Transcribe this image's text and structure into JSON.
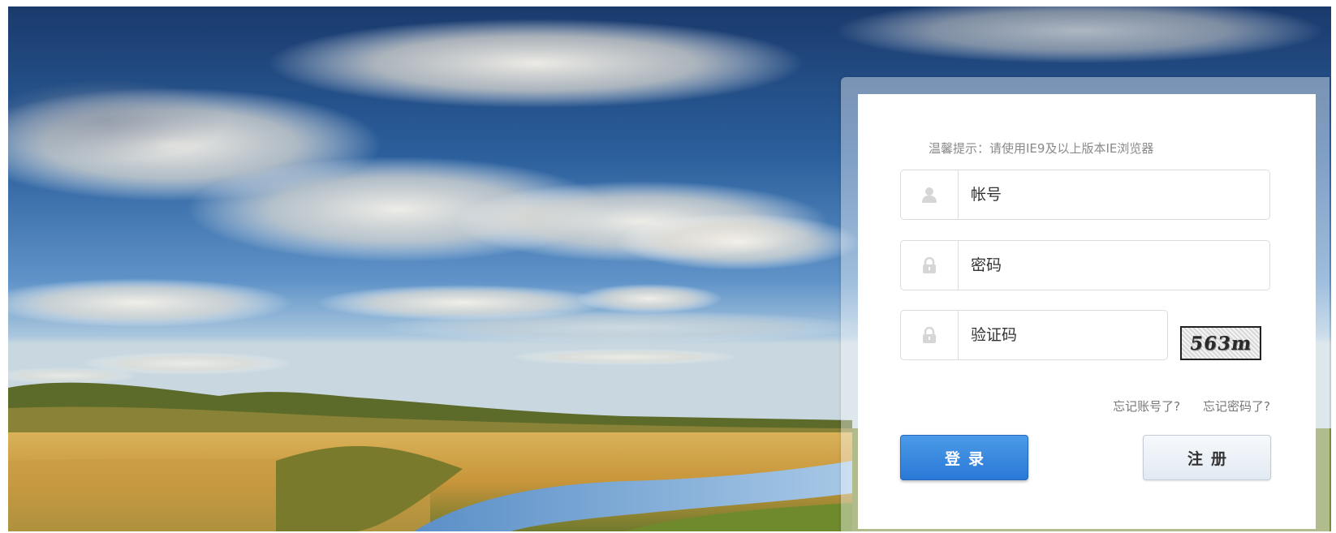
{
  "tip": "温馨提示：请使用IE9及以上版本IE浏览器",
  "form": {
    "account": {
      "placeholder": "帐号",
      "icon": "user-icon"
    },
    "password": {
      "placeholder": "密码",
      "icon": "lock-icon"
    },
    "captcha": {
      "placeholder": "验证码",
      "icon": "lock-icon",
      "image_text": "563m"
    }
  },
  "links": {
    "forgot_account": "忘记账号了?",
    "forgot_password": "忘记密码了?"
  },
  "buttons": {
    "login": "登录",
    "register": "注册"
  },
  "colors": {
    "login_button": "#2a78d6",
    "register_button": "#e9eff5",
    "sky": "#1f4e87"
  }
}
